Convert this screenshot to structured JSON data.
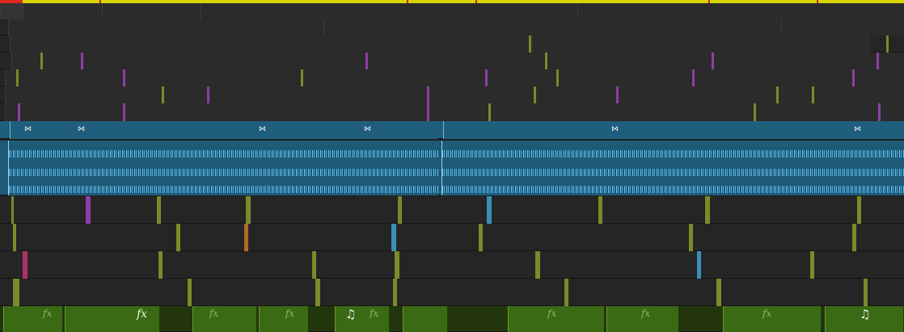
{
  "app": {
    "title": ""
  },
  "timeline": {
    "colors": {
      "ruler": "#d9d400",
      "playhead_marker": "#e0261f",
      "video_clip": "#7b8a2a",
      "title_clip": "#8d3fa6",
      "sync_track": "#1f5f7d",
      "audio_waveform": "#6fc6f1",
      "fx_clip": "#3b6a15"
    },
    "labels": {
      "fx": "fx",
      "music_note": "♫",
      "transition_marker": "⋈"
    }
  }
}
